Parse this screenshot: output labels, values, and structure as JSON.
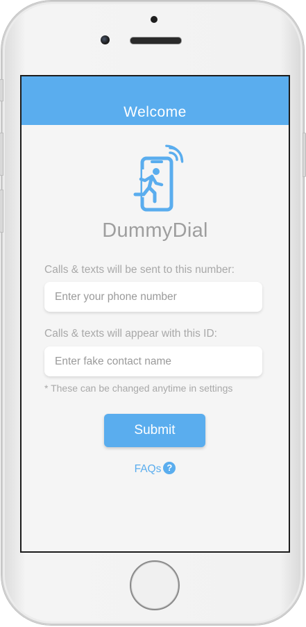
{
  "header": {
    "title": "Welcome"
  },
  "brand": {
    "name": "DummyDial",
    "logo_icon": "running-man-phone-icon"
  },
  "form": {
    "phone_label": "Calls & texts will be sent to this number:",
    "phone_placeholder": "Enter your phone number",
    "phone_value": "",
    "name_label": "Calls & texts will appear with this ID:",
    "name_placeholder": "Enter fake contact name",
    "name_value": "",
    "note": "* These can be changed anytime in settings",
    "submit_label": "Submit"
  },
  "faq": {
    "label": "FAQs",
    "icon": "question-circle-icon",
    "icon_glyph": "?"
  },
  "colors": {
    "accent": "#5aadee",
    "background": "#f5f5f5",
    "muted_text": "#a8a8a8",
    "brand_text": "#9e9e9e"
  }
}
